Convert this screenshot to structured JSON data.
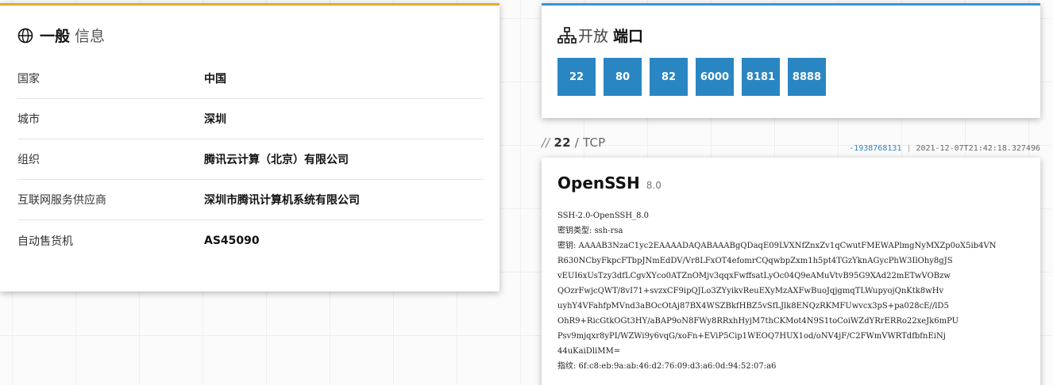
{
  "general": {
    "title_strong": "一般",
    "title_light": "信息",
    "accent": "#e8a72b",
    "rows": [
      {
        "key": "国家",
        "value": "中国"
      },
      {
        "key": "城市",
        "value": "深圳"
      },
      {
        "key": "组织",
        "value": "腾讯云计算（北京）有限公司"
      },
      {
        "key": "互联网服务供应商",
        "value": "深圳市腾讯计算机系统有限公司"
      },
      {
        "key": "自动售货机",
        "value": "AS45090"
      }
    ]
  },
  "ports": {
    "title_light": "开放",
    "title_strong": "端口",
    "accent": "#3a96d3",
    "button_color": "#2a86c3",
    "items": [
      "22",
      "80",
      "82",
      "6000",
      "8181",
      "8888"
    ]
  },
  "service": {
    "slashes": "//",
    "port": "22",
    "protocol": "/ TCP",
    "hash": "-1938768131",
    "timestamp": "2021-12-07T21:42:18.327496",
    "name": "OpenSSH",
    "version": "8.0",
    "banner": [
      "SSH-2.0-OpenSSH_8.0",
      "密钥类型: ssh-rsa",
      "密钥: AAAAB3NzaC1yc2EAAAADAQABAAABgQDaqE09LVXNfZnxZv1qCwutFMEWAPlmgNyMXZp0oX5ib4VN",
      "R630NCbyFkpcFTbpJNmEdDV/Vr8LFxOT4efomrCQqwbpZxm1h5pt4TGzYknAGycPhW3IlOhy8gJS",
      "vEUI6xUsTzy3dfLCgvXYco0ATZnOMjv3qqxFwffsatLyOc04Q9eAMuVtvB95G9XAd22mETwVOBzw",
      "QOzrFwjcQWT/8vI71+svzxCF9ipQJLo3ZYyikvReuEXyMzAXFwBuoJqjgmqTLWupyojQnKtk8wHv",
      "uyhY4VFahfpMVnd3aBOcOtAj87BX4WSZBkfHBZ5vSfLJlk8ENQzRKMFUwvcx3pS+pa028cE//lD5",
      "OhR9+RicGtkOGt3HY/aBAP9oN8FWy8RRxhHyjM7thCKMot4N9S1toCoiWZdYRrERRo22xeJk6mPU",
      "Psv9mjqxr8yPI/WZWi9y6vqG/xoFn+EViP5Cip1WEOQ7HUX1od/oNV4jF/C2FWmVWRTdfbfnEiNj",
      "44uKaiDliMM=",
      "指纹: 6f:c8:eb:9a:ab:46:d2:76:09:d3:a6:0d:94:52:07:a6"
    ]
  }
}
